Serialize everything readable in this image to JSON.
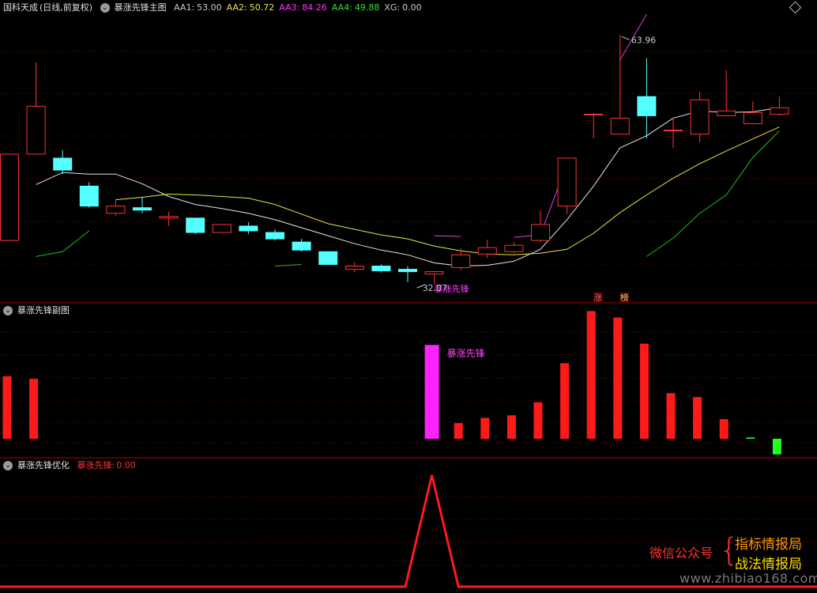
{
  "main_panel": {
    "stock_label": "国科天成",
    "period_label": "(日线,前复权)",
    "indicator_label": "暴涨先锋主图",
    "fields": [
      {
        "label": "AA1:",
        "value": "53.00",
        "color": "#c8c8c8"
      },
      {
        "label": "AA2:",
        "value": "50.72",
        "color": "#e6e64c"
      },
      {
        "label": "AA3:",
        "value": "84.26",
        "color": "#ff33ff"
      },
      {
        "label": "AA4:",
        "value": "49.88",
        "color": "#33dd33"
      },
      {
        "label": "XG:",
        "value": "0.00",
        "color": "#c8c8c8"
      }
    ],
    "high_mark": "63.96",
    "low_mark": "32.07",
    "signal_text": "暴涨先锋",
    "tag_zhang": "涨",
    "tag_bang": "榜"
  },
  "sub_panel1": {
    "indicator_label": "暴涨先锋副图",
    "signal_text": "暴涨先锋"
  },
  "sub_panel2": {
    "indicator_label": "暴涨先锋优化",
    "field_label": "暴涨先锋:",
    "field_value": "0.00"
  },
  "watermark": {
    "wechat": "微信公众号",
    "name1": "指标情报局",
    "name2": "战法情报局",
    "url": "www.zhibiao168.com"
  },
  "colors": {
    "up": "#ff3333",
    "down": "#54ffff",
    "grid": "#8a0000",
    "separator": "#b00000",
    "ma_white": "#e6e6e6",
    "ma_yellow": "#e6e64c",
    "ma_magenta": "#e040e0",
    "ma_green": "#22bb22",
    "bar_up": "#ff1a1a",
    "bar_magenta": "#ff22ff",
    "bar_green": "#22ff22"
  },
  "chart_data": [
    {
      "type": "candlestick",
      "name": "main",
      "ylim": [
        30.5,
        66.5
      ],
      "candles": [
        {
          "x": 0,
          "o": 38.2,
          "c": 49.0,
          "h": 49.0,
          "l": 38.2
        },
        {
          "x": 1,
          "o": 49.0,
          "c": 55.0,
          "h": 60.5,
          "l": 49.0
        },
        {
          "x": 2,
          "o": 48.5,
          "c": 47.0,
          "h": 49.5,
          "l": 46.5
        },
        {
          "x": 3,
          "o": 45.0,
          "c": 42.5,
          "h": 45.5,
          "l": 42.3
        },
        {
          "x": 4,
          "o": 41.6,
          "c": 42.5,
          "h": 43.3,
          "l": 41.3
        },
        {
          "x": 5,
          "o": 42.3,
          "c": 42.0,
          "h": 43.6,
          "l": 41.6
        },
        {
          "x": 6,
          "o": 41.0,
          "c": 41.2,
          "h": 41.8,
          "l": 40.0
        },
        {
          "x": 7,
          "o": 41.0,
          "c": 39.2,
          "h": 41.0,
          "l": 39.0
        },
        {
          "x": 8,
          "o": 39.2,
          "c": 40.2,
          "h": 40.2,
          "l": 39.2
        },
        {
          "x": 9,
          "o": 40.0,
          "c": 39.4,
          "h": 40.5,
          "l": 39.0
        },
        {
          "x": 10,
          "o": 39.2,
          "c": 38.4,
          "h": 39.6,
          "l": 38.2
        },
        {
          "x": 11,
          "o": 38.0,
          "c": 37.0,
          "h": 38.4,
          "l": 36.8
        },
        {
          "x": 12,
          "o": 36.8,
          "c": 35.2,
          "h": 36.8,
          "l": 35.2
        },
        {
          "x": 13,
          "o": 34.6,
          "c": 35.0,
          "h": 35.5,
          "l": 34.2
        },
        {
          "x": 14,
          "o": 35.0,
          "c": 34.4,
          "h": 35.2,
          "l": 34.2
        },
        {
          "x": 15,
          "o": 34.6,
          "c": 34.3,
          "h": 35.0,
          "l": 33.0
        },
        {
          "x": 16,
          "o": 34.0,
          "c": 34.3,
          "h": 34.4,
          "l": 32.7
        },
        {
          "x": 17,
          "o": 34.8,
          "c": 36.4,
          "h": 37.2,
          "l": 34.5
        },
        {
          "x": 18,
          "o": 36.5,
          "c": 37.3,
          "h": 38.3,
          "l": 36.0
        },
        {
          "x": 19,
          "o": 36.8,
          "c": 37.6,
          "h": 38.0,
          "l": 36.6
        },
        {
          "x": 20,
          "o": 38.2,
          "c": 40.2,
          "h": 42.0,
          "l": 38.0
        },
        {
          "x": 21,
          "o": 42.5,
          "c": 48.5,
          "h": 48.5,
          "l": 41.5
        },
        {
          "x": 22,
          "o": 54.0,
          "c": 54.0,
          "h": 54.1,
          "l": 51.0
        },
        {
          "x": 23,
          "o": 51.5,
          "c": 53.5,
          "h": 63.9,
          "l": 51.5
        },
        {
          "x": 24,
          "o": 56.2,
          "c": 53.8,
          "h": 61.0,
          "l": 51.0
        },
        {
          "x": 25,
          "o": 52.0,
          "c": 52.0,
          "h": 53.6,
          "l": 49.8
        },
        {
          "x": 26,
          "o": 51.5,
          "c": 55.8,
          "h": 56.8,
          "l": 50.5
        },
        {
          "x": 27,
          "o": 53.8,
          "c": 54.4,
          "h": 59.5,
          "l": 53.8
        },
        {
          "x": 28,
          "o": 52.8,
          "c": 54.2,
          "h": 55.6,
          "l": 52.8
        },
        {
          "x": 29,
          "o": 54.0,
          "c": 54.8,
          "h": 56.2,
          "l": 53.8
        }
      ],
      "series": [
        {
          "values": [
            null,
            45.2,
            46.7,
            46.5,
            46.5,
            45.3,
            43.7,
            42.7,
            42.2,
            41.6,
            40.8,
            39.8,
            38.8,
            37.8,
            37.0,
            36.4,
            35.4,
            35.0,
            35.1,
            35.6,
            37.1,
            40.8,
            45.0,
            49.8,
            51.3,
            53.5,
            54.4,
            54.2,
            54.3,
            54.8
          ]
        },
        {
          "values": [
            null,
            null,
            null,
            null,
            43.3,
            43.6,
            44.0,
            43.9,
            43.7,
            43.5,
            42.7,
            41.5,
            40.3,
            39.6,
            38.9,
            38.4,
            37.5,
            36.9,
            36.5,
            36.4,
            36.6,
            37.1,
            39.1,
            41.7,
            43.9,
            46.0,
            47.8,
            49.4,
            50.9,
            52.4
          ]
        },
        {
          "values": [
            null,
            null,
            null,
            null,
            null,
            51.0,
            null,
            47.7,
            null,
            null,
            47.0,
            null,
            null,
            41.8,
            null,
            null,
            38.8,
            38.7,
            null,
            38.6,
            38.9,
            47.8,
            null,
            60.8,
            66.5,
            null,
            null,
            null,
            null,
            null
          ]
        },
        {
          "values": [
            null,
            36.2,
            36.8,
            39.4,
            null,
            null,
            35.5,
            null,
            null,
            null,
            35.0,
            35.2,
            null,
            null,
            null,
            null,
            null,
            null,
            null,
            null,
            null,
            null,
            null,
            null,
            36.2,
            38.5,
            41.6,
            43.9,
            48.6,
            51.9
          ]
        }
      ],
      "annotations": [
        {
          "text": "63.96",
          "x": 23,
          "y": 63.9
        },
        {
          "text": "32.07",
          "x": 16,
          "y": 32.07
        },
        {
          "text": "暴涨先锋",
          "x": 16
        },
        {
          "text": "涨",
          "x": 22
        },
        {
          "text": "榜",
          "x": 23
        }
      ]
    },
    {
      "type": "bar",
      "name": "sub1",
      "ylim": [
        -1.4,
        9.4
      ],
      "values": [
        4.8,
        4.6,
        null,
        null,
        null,
        null,
        null,
        null,
        null,
        null,
        null,
        null,
        null,
        null,
        null,
        null,
        7.2,
        1.2,
        1.6,
        1.8,
        2.8,
        5.8,
        9.8,
        9.3,
        7.3,
        3.5,
        3.2,
        1.5,
        0.1,
        -1.2
      ],
      "colors": [
        "up",
        "up",
        null,
        null,
        null,
        null,
        null,
        null,
        null,
        null,
        null,
        null,
        null,
        null,
        null,
        null,
        "magenta",
        "up",
        "up",
        "up",
        "up",
        "up",
        "up",
        "up",
        "up",
        "up",
        "up",
        "up",
        "green",
        "green"
      ]
    },
    {
      "type": "line",
      "name": "sub2",
      "ylim": [
        0,
        1
      ],
      "values": [
        0,
        0,
        0,
        0,
        0,
        0,
        0,
        0,
        0,
        0,
        0,
        0,
        0,
        0,
        0,
        0,
        1,
        0,
        0,
        0,
        0,
        0,
        0,
        0,
        0,
        0,
        0,
        0,
        0,
        0
      ]
    }
  ]
}
